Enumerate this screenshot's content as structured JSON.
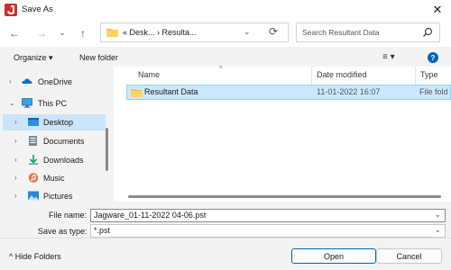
{
  "window": {
    "title": "Save As",
    "close_glyph": "✕"
  },
  "nav": {
    "back_glyph": "←",
    "forward_glyph": "→",
    "recent_glyph": "⌄",
    "up_glyph": "↑",
    "address": {
      "crumbs": "« Desk... › Resulta...",
      "dropdown_glyph": "⌄",
      "refresh_glyph": "⟳"
    },
    "search": {
      "placeholder": "Search Resultant Data"
    }
  },
  "toolbar": {
    "organize_label": "Organize ▾",
    "new_folder_label": "New folder",
    "view_glyph": "≡ ▾",
    "help_glyph": "?"
  },
  "sidebar": {
    "items": [
      {
        "label": "OneDrive",
        "chevron": "›"
      },
      {
        "label": "This PC",
        "chevron": "⌄"
      },
      {
        "label": "Desktop",
        "chevron": "›"
      },
      {
        "label": "Documents",
        "chevron": "›"
      },
      {
        "label": "Downloads",
        "chevron": "›"
      },
      {
        "label": "Music",
        "chevron": "›"
      },
      {
        "label": "Pictures",
        "chevron": "›"
      }
    ]
  },
  "list": {
    "columns": [
      "Name",
      "Date modified",
      "Type"
    ],
    "sort_glyph": "^",
    "rows": [
      {
        "name": "Resultant Data",
        "date": "11-01-2022 16:07",
        "type": "File fold"
      }
    ]
  },
  "form": {
    "file_name_label": "File name:",
    "file_name_value": "Jagware_01-11-2022 04-06.pst",
    "save_type_label": "Save as type:",
    "save_type_value": "*.pst",
    "dropdown_glyph": "⌄"
  },
  "footer": {
    "hide_folders_label": "^  Hide Folders",
    "open_label": "Open",
    "cancel_label": "Cancel"
  },
  "colors": {
    "accent": "#0067c0",
    "selection": "#cce8ff"
  }
}
